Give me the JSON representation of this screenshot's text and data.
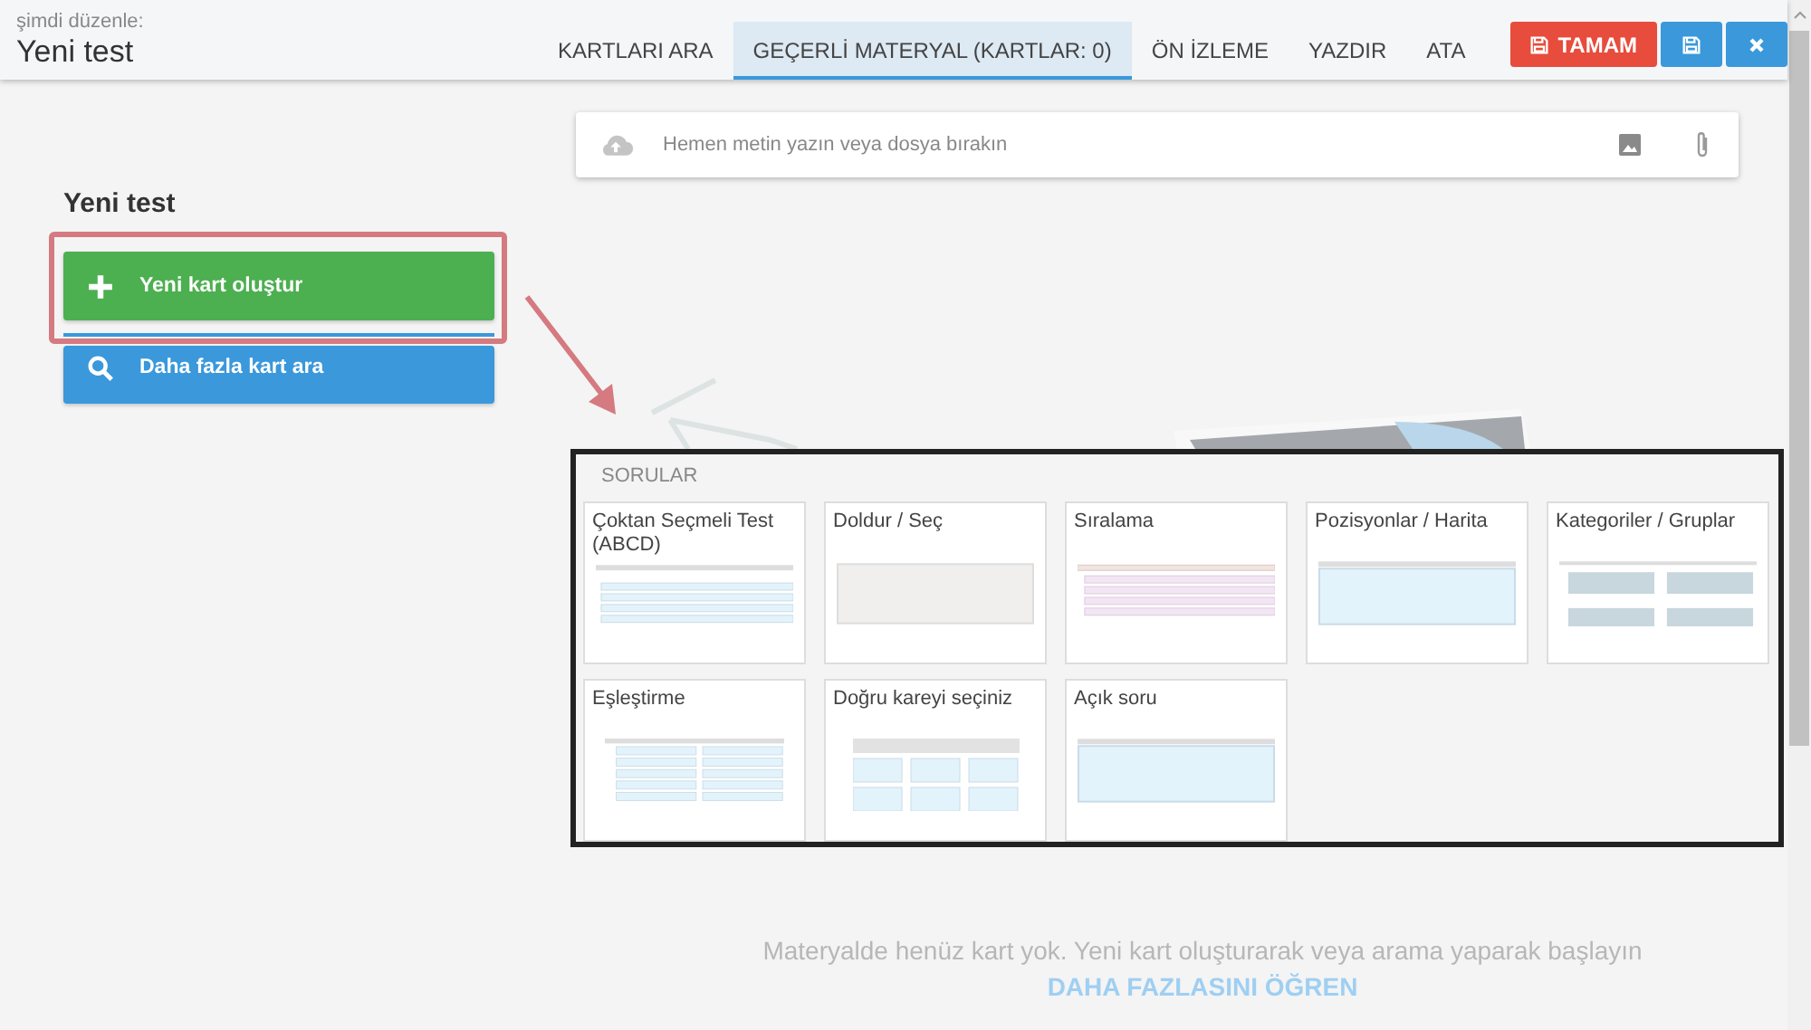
{
  "header": {
    "subtitle": "şimdi düzenle:",
    "title": "Yeni test"
  },
  "tabs": [
    {
      "label": "KARTLARI ARA",
      "selected": false
    },
    {
      "label": "GEÇERLİ MATERYAL (KARTLAR: 0)",
      "selected": true
    },
    {
      "label": "ÖN İZLEME",
      "selected": false
    },
    {
      "label": "YAZDIR",
      "selected": false
    },
    {
      "label": "ATA",
      "selected": false
    }
  ],
  "done_button": "TAMAM",
  "input": {
    "placeholder": "Hemen metin yazın veya dosya bırakın"
  },
  "sidebar": {
    "title": "Yeni test",
    "create_button": "Yeni kart oluştur",
    "search_button": "Daha fazla kart ara"
  },
  "popup": {
    "heading": "SORULAR",
    "cards": [
      {
        "kind": "choice",
        "label": "Çoktan Seçmeli Test (ABCD)"
      },
      {
        "kind": "fill",
        "label": "Doldur / Seç"
      },
      {
        "kind": "order",
        "label": "Sıralama"
      },
      {
        "kind": "map",
        "label": "Pozisyonlar / Harita"
      },
      {
        "kind": "categories",
        "label": "Kategoriler / Gruplar"
      },
      {
        "kind": "matching",
        "label": "Eşleştirme"
      },
      {
        "kind": "grid",
        "label": "Doğru kareyi seçiniz"
      },
      {
        "kind": "open",
        "label": "Açık soru"
      }
    ]
  },
  "empty_state": {
    "message": "Materyalde henüz kart yok. Yeni kart oluşturarak veya arama yaparak başlayın",
    "link": "DAHA FAZLASINI ÖĞREN"
  }
}
